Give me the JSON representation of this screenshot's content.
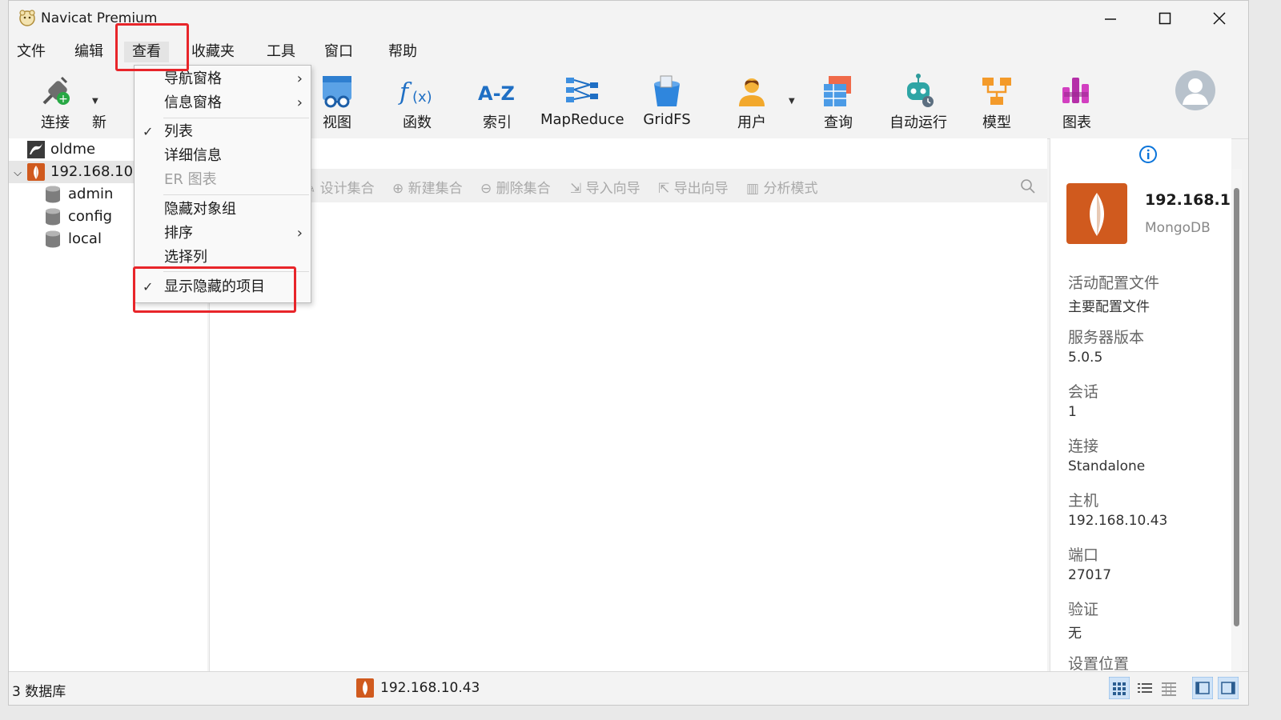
{
  "app": {
    "title": "Navicat Premium"
  },
  "menubar": [
    "文件",
    "编辑",
    "查看",
    "收藏夹",
    "工具",
    "窗口",
    "帮助"
  ],
  "toolbar": {
    "connect": "连接",
    "new_partial": "新",
    "view": "视图",
    "function": "函数",
    "index": "索引",
    "mapreduce": "MapReduce",
    "gridfs": "GridFS",
    "user": "用户",
    "query": "查询",
    "automation": "自动运行",
    "model": "模型",
    "chart": "图表"
  },
  "view_menu": {
    "items": [
      {
        "label": "导航窗格",
        "checked": false,
        "submenu": true,
        "disabled": false
      },
      {
        "label": "信息窗格",
        "checked": false,
        "submenu": true,
        "disabled": false
      },
      {
        "label": "列表",
        "checked": true,
        "submenu": false,
        "disabled": false
      },
      {
        "label": "详细信息",
        "checked": false,
        "submenu": false,
        "disabled": false
      },
      {
        "label": "ER 图表",
        "checked": false,
        "submenu": false,
        "disabled": true
      },
      {
        "label": "隐藏对象组",
        "checked": false,
        "submenu": false,
        "disabled": false
      },
      {
        "label": "排序",
        "checked": false,
        "submenu": true,
        "disabled": false
      },
      {
        "label": "选择列",
        "checked": false,
        "submenu": false,
        "disabled": false
      },
      {
        "label": "显示隐藏的项目",
        "checked": true,
        "submenu": false,
        "disabled": false
      }
    ]
  },
  "nav_tree": {
    "connections": [
      {
        "name": "oldme"
      },
      {
        "name": "192.168.10",
        "expanded": true,
        "databases": [
          "admin",
          "config",
          "local"
        ]
      }
    ]
  },
  "object_toolbar": {
    "design": "设计集合",
    "new": "新建集合",
    "delete": "删除集合",
    "import": "导入向导",
    "export": "导出向导",
    "analyze": "分析模式"
  },
  "info_pane": {
    "name": "192.168.1",
    "type": "MongoDB",
    "fields": [
      {
        "label": "活动配置文件",
        "value": "主要配置文件"
      },
      {
        "label": "服务器版本",
        "value": "5.0.5"
      },
      {
        "label": "会话",
        "value": "1"
      },
      {
        "label": "连接",
        "value": "Standalone"
      },
      {
        "label": "主机",
        "value": "192.168.10.43"
      },
      {
        "label": "端口",
        "value": "27017"
      },
      {
        "label": "验证",
        "value": "无"
      },
      {
        "label": "设置位置",
        "value": ""
      }
    ]
  },
  "statusbar": {
    "db_count": "3 数据库",
    "connection": "192.168.10.43"
  },
  "colors": {
    "highlight": "#e8252a",
    "mongodb": "#d05a1e",
    "accent": "#0a74da"
  }
}
